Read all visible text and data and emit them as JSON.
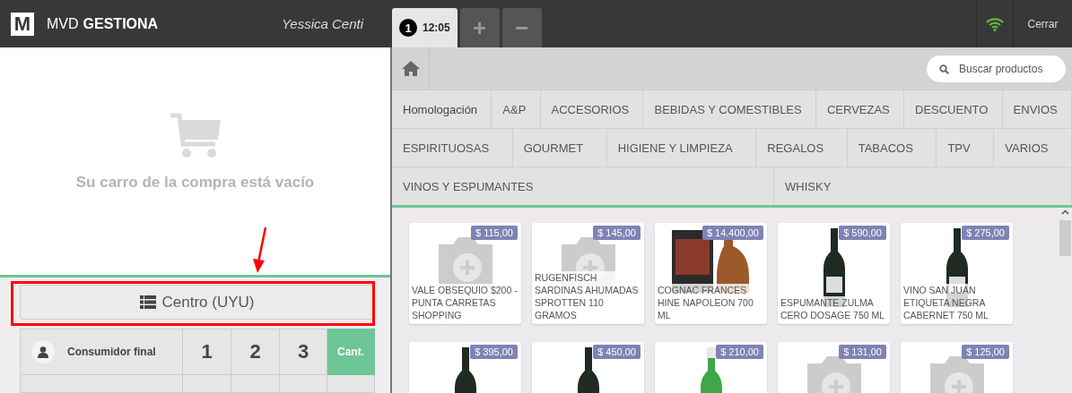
{
  "topbar": {
    "logo_letter": "M",
    "brand_light": "MVD",
    "brand_bold": "GESTIONA",
    "user": "Yessica Centi",
    "order_tabs": [
      {
        "number": "1",
        "time": "12:05",
        "selected": true
      }
    ],
    "add_label": "+",
    "remove_label": "−",
    "close_label": "Cerrar"
  },
  "cart": {
    "empty_message": "Su carro de la compra está vacío",
    "pricelist": "Centro (UYU)",
    "customer": "Consumidor final",
    "keys": [
      {
        "label": "1",
        "selected": false
      },
      {
        "label": "2",
        "selected": false
      },
      {
        "label": "3",
        "selected": false
      },
      {
        "label": "Cant.",
        "selected": true
      }
    ]
  },
  "search": {
    "placeholder": "Buscar productos"
  },
  "category_rows": [
    [
      {
        "label": "Homologación",
        "kind": "mixed"
      },
      {
        "label": "A&P",
        "kind": "caps"
      },
      {
        "label": "ACCESORIOS",
        "kind": "caps"
      },
      {
        "label": "BEBIDAS Y COMESTIBLES",
        "kind": "caps"
      },
      {
        "label": "CERVEZAS",
        "kind": "caps"
      },
      {
        "label": "DESCUENTO",
        "kind": "caps"
      },
      {
        "label": "ENVIOS",
        "kind": "caps"
      }
    ],
    [
      {
        "label": "ESPIRITUOSAS",
        "kind": "caps"
      },
      {
        "label": "GOURMET",
        "kind": "caps"
      },
      {
        "label": "HIGIENE Y LIMPIEZA",
        "kind": "caps"
      },
      {
        "label": "REGALOS",
        "kind": "caps"
      },
      {
        "label": "TABACOS",
        "kind": "caps"
      },
      {
        "label": "TPV",
        "kind": "caps"
      },
      {
        "label": "VARIOS",
        "kind": "caps"
      }
    ],
    [
      {
        "label": "VINOS Y ESPUMANTES",
        "kind": "caps"
      },
      {
        "label": "WHISKY",
        "kind": "caps"
      }
    ]
  ],
  "products": [
    {
      "price": "$ 115,00",
      "name": "VALE OBSEQUIO $200 - PUNTA CARRETAS SHOPPING",
      "kind": "placeholder"
    },
    {
      "price": "$ 145,00",
      "name": "RUGENFISCH SARDINAS AHUMADAS SPROTTEN 110 GRAMOS",
      "kind": "placeholder"
    },
    {
      "price": "$ 14.400,00",
      "name": "COGNAC FRANCES HINE NAPOLEON 700 ML",
      "kind": "box"
    },
    {
      "price": "$ 590,00",
      "name": "ESPUMANTE ZULMA CERO DOSAGE 750 ML",
      "kind": "bottle"
    },
    {
      "price": "$ 275,00",
      "name": "VINO SAN JUAN ETIQUETA NEGRA CABERNET 750 ML",
      "kind": "bottle"
    },
    {
      "price": "$ 395,00",
      "kind": "bottle"
    },
    {
      "price": "$ 450,00",
      "kind": "bottle"
    },
    {
      "price": "$ 210,00",
      "kind": "sparkling"
    },
    {
      "price": "$ 131,00",
      "kind": "placeholder"
    },
    {
      "price": "$ 125,00",
      "kind": "placeholder"
    }
  ]
}
